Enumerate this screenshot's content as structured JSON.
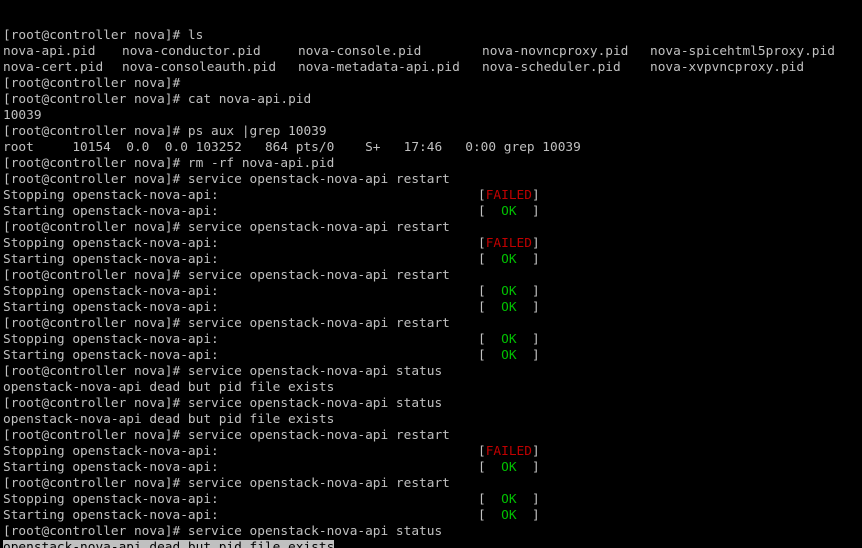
{
  "terminal": {
    "prompt": "[root@controller nova]# ",
    "lines": [
      {
        "kind": "cmd",
        "text": "ls"
      },
      {
        "kind": "cols",
        "cells": [
          "nova-api.pid",
          "nova-conductor.pid",
          "nova-console.pid",
          "nova-novncproxy.pid",
          "nova-spicehtml5proxy.pid"
        ]
      },
      {
        "kind": "cols",
        "cells": [
          "nova-cert.pid",
          "nova-consoleauth.pid",
          "nova-metadata-api.pid",
          "nova-scheduler.pid",
          "nova-xvpvncproxy.pid"
        ]
      },
      {
        "kind": "cmd",
        "text": ""
      },
      {
        "kind": "cmd",
        "text": "cat nova-api.pid"
      },
      {
        "kind": "out",
        "text": "10039"
      },
      {
        "kind": "cmd",
        "text": "ps aux |grep 10039"
      },
      {
        "kind": "out",
        "text": "root     10154  0.0  0.0 103252   864 pts/0    S+   17:46   0:00 grep 10039"
      },
      {
        "kind": "cmd",
        "text": "rm -rf nova-api.pid"
      },
      {
        "kind": "cmd",
        "text": "service openstack-nova-api restart"
      },
      {
        "kind": "svc",
        "label": "Stopping openstack-nova-api:",
        "status": "FAILED"
      },
      {
        "kind": "svc",
        "label": "Starting openstack-nova-api:",
        "status": "OK"
      },
      {
        "kind": "cmd",
        "text": "service openstack-nova-api restart"
      },
      {
        "kind": "svc",
        "label": "Stopping openstack-nova-api:",
        "status": "FAILED"
      },
      {
        "kind": "svc",
        "label": "Starting openstack-nova-api:",
        "status": "OK"
      },
      {
        "kind": "cmd",
        "text": "service openstack-nova-api restart"
      },
      {
        "kind": "svc",
        "label": "Stopping openstack-nova-api:",
        "status": "OK"
      },
      {
        "kind": "svc",
        "label": "Starting openstack-nova-api:",
        "status": "OK"
      },
      {
        "kind": "cmd",
        "text": "service openstack-nova-api restart"
      },
      {
        "kind": "svc",
        "label": "Stopping openstack-nova-api:",
        "status": "OK"
      },
      {
        "kind": "svc",
        "label": "Starting openstack-nova-api:",
        "status": "OK"
      },
      {
        "kind": "cmd",
        "text": "service openstack-nova-api status"
      },
      {
        "kind": "out",
        "text": "openstack-nova-api dead but pid file exists"
      },
      {
        "kind": "cmd",
        "text": "service openstack-nova-api status"
      },
      {
        "kind": "out",
        "text": "openstack-nova-api dead but pid file exists"
      },
      {
        "kind": "cmd",
        "text": "service openstack-nova-api restart"
      },
      {
        "kind": "svc",
        "label": "Stopping openstack-nova-api:",
        "status": "FAILED"
      },
      {
        "kind": "svc",
        "label": "Starting openstack-nova-api:",
        "status": "OK"
      },
      {
        "kind": "cmd",
        "text": "service openstack-nova-api restart"
      },
      {
        "kind": "svc",
        "label": "Stopping openstack-nova-api:",
        "status": "OK"
      },
      {
        "kind": "svc",
        "label": "Starting openstack-nova-api:",
        "status": "OK"
      },
      {
        "kind": "cmd",
        "text": "service openstack-nova-api status"
      },
      {
        "kind": "selected",
        "text": "openstack-nova-api dead but pid file exists"
      },
      {
        "kind": "cursorline",
        "text": ""
      }
    ],
    "colors": {
      "background": "#000000",
      "foreground": "#c0c0c0",
      "failed": "#c00000",
      "ok": "#00c000",
      "cursor": "#00ff00",
      "selection_bg": "#c0c0c0"
    }
  }
}
